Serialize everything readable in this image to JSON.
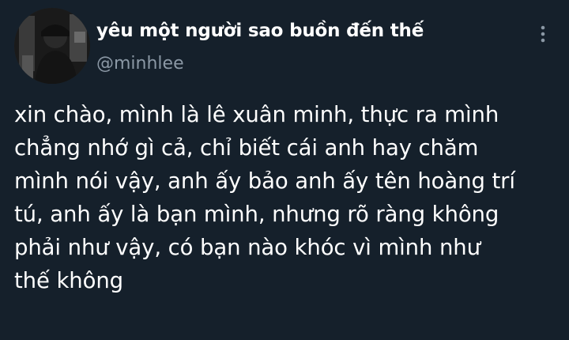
{
  "tweet": {
    "author": {
      "display_name": "yêu một người sao buồn đến thế",
      "handle": "@minhlee",
      "avatar_icon": "profile-photo"
    },
    "more_icon": "vertical-ellipsis-icon",
    "text": "xin chào, mình là lê xuân minh, thực ra mình\nchẳng nhớ gì cả, chỉ biết cái anh hay chăm\nmình nói vậy, anh ấy bảo anh ấy tên hoàng trí\ntú, anh ấy là bạn mình, nhưng rõ ràng không\nphải như vậy, có bạn nào khóc vì mình như\nthế không"
  },
  "colors": {
    "background": "#15202b",
    "text_primary": "#ffffff",
    "text_secondary": "#8b98a5"
  }
}
